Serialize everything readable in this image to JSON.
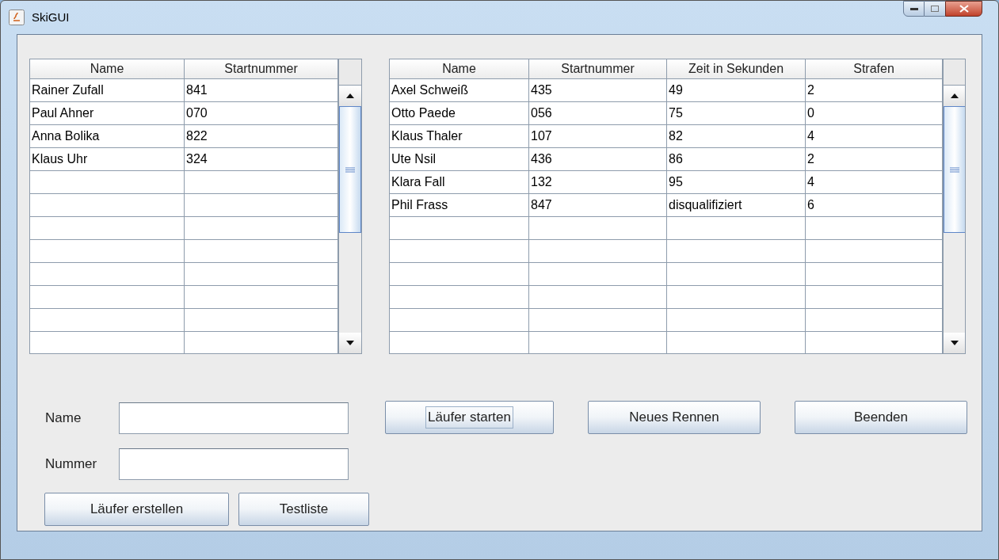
{
  "window": {
    "title": "SkiGUI"
  },
  "runners_table": {
    "columns": [
      "Name",
      "Startnummer"
    ],
    "rows": [
      [
        "Rainer Zufall",
        "841"
      ],
      [
        "Paul Ahner",
        "070"
      ],
      [
        "Anna Bolika",
        "822"
      ],
      [
        "Klaus Uhr",
        "324"
      ]
    ]
  },
  "results_table": {
    "columns": [
      "Name",
      "Startnummer",
      "Zeit in Sekunden",
      "Strafen"
    ],
    "rows": [
      [
        "Axel Schweiß",
        "435",
        "49",
        "2"
      ],
      [
        "Otto Paede",
        "056",
        "75",
        "0"
      ],
      [
        "Klaus Thaler",
        "107",
        "82",
        "4"
      ],
      [
        "Ute Nsil",
        "436",
        "86",
        "2"
      ],
      [
        "Klara Fall",
        "132",
        "95",
        "4"
      ],
      [
        "Phil Frass",
        "847",
        "disqualifiziert",
        "6"
      ]
    ]
  },
  "form": {
    "fields": [
      {
        "label": "Name"
      },
      {
        "label": "Nummer"
      }
    ]
  },
  "buttons": [
    {
      "label": "Läufer erstellen",
      "focused": false
    },
    {
      "label": "Testliste",
      "focused": false
    },
    {
      "label": "Läufer starten",
      "focused": true
    },
    {
      "label": "Neues Rennen",
      "focused": false
    },
    {
      "label": "Beenden",
      "focused": false
    }
  ]
}
